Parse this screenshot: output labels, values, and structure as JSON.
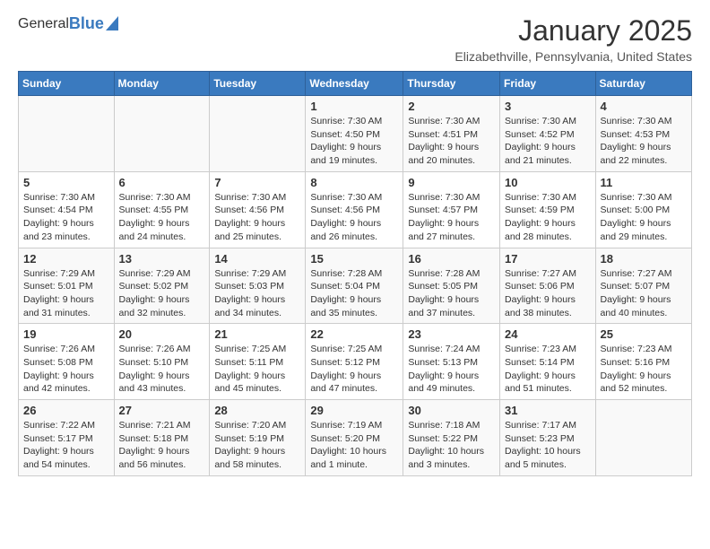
{
  "header": {
    "logo_general": "General",
    "logo_blue": "Blue",
    "month_title": "January 2025",
    "location": "Elizabethville, Pennsylvania, United States"
  },
  "weekdays": [
    "Sunday",
    "Monday",
    "Tuesday",
    "Wednesday",
    "Thursday",
    "Friday",
    "Saturday"
  ],
  "weeks": [
    [
      {
        "day": "",
        "info": ""
      },
      {
        "day": "",
        "info": ""
      },
      {
        "day": "",
        "info": ""
      },
      {
        "day": "1",
        "info": "Sunrise: 7:30 AM\nSunset: 4:50 PM\nDaylight: 9 hours\nand 19 minutes."
      },
      {
        "day": "2",
        "info": "Sunrise: 7:30 AM\nSunset: 4:51 PM\nDaylight: 9 hours\nand 20 minutes."
      },
      {
        "day": "3",
        "info": "Sunrise: 7:30 AM\nSunset: 4:52 PM\nDaylight: 9 hours\nand 21 minutes."
      },
      {
        "day": "4",
        "info": "Sunrise: 7:30 AM\nSunset: 4:53 PM\nDaylight: 9 hours\nand 22 minutes."
      }
    ],
    [
      {
        "day": "5",
        "info": "Sunrise: 7:30 AM\nSunset: 4:54 PM\nDaylight: 9 hours\nand 23 minutes."
      },
      {
        "day": "6",
        "info": "Sunrise: 7:30 AM\nSunset: 4:55 PM\nDaylight: 9 hours\nand 24 minutes."
      },
      {
        "day": "7",
        "info": "Sunrise: 7:30 AM\nSunset: 4:56 PM\nDaylight: 9 hours\nand 25 minutes."
      },
      {
        "day": "8",
        "info": "Sunrise: 7:30 AM\nSunset: 4:56 PM\nDaylight: 9 hours\nand 26 minutes."
      },
      {
        "day": "9",
        "info": "Sunrise: 7:30 AM\nSunset: 4:57 PM\nDaylight: 9 hours\nand 27 minutes."
      },
      {
        "day": "10",
        "info": "Sunrise: 7:30 AM\nSunset: 4:59 PM\nDaylight: 9 hours\nand 28 minutes."
      },
      {
        "day": "11",
        "info": "Sunrise: 7:30 AM\nSunset: 5:00 PM\nDaylight: 9 hours\nand 29 minutes."
      }
    ],
    [
      {
        "day": "12",
        "info": "Sunrise: 7:29 AM\nSunset: 5:01 PM\nDaylight: 9 hours\nand 31 minutes."
      },
      {
        "day": "13",
        "info": "Sunrise: 7:29 AM\nSunset: 5:02 PM\nDaylight: 9 hours\nand 32 minutes."
      },
      {
        "day": "14",
        "info": "Sunrise: 7:29 AM\nSunset: 5:03 PM\nDaylight: 9 hours\nand 34 minutes."
      },
      {
        "day": "15",
        "info": "Sunrise: 7:28 AM\nSunset: 5:04 PM\nDaylight: 9 hours\nand 35 minutes."
      },
      {
        "day": "16",
        "info": "Sunrise: 7:28 AM\nSunset: 5:05 PM\nDaylight: 9 hours\nand 37 minutes."
      },
      {
        "day": "17",
        "info": "Sunrise: 7:27 AM\nSunset: 5:06 PM\nDaylight: 9 hours\nand 38 minutes."
      },
      {
        "day": "18",
        "info": "Sunrise: 7:27 AM\nSunset: 5:07 PM\nDaylight: 9 hours\nand 40 minutes."
      }
    ],
    [
      {
        "day": "19",
        "info": "Sunrise: 7:26 AM\nSunset: 5:08 PM\nDaylight: 9 hours\nand 42 minutes."
      },
      {
        "day": "20",
        "info": "Sunrise: 7:26 AM\nSunset: 5:10 PM\nDaylight: 9 hours\nand 43 minutes."
      },
      {
        "day": "21",
        "info": "Sunrise: 7:25 AM\nSunset: 5:11 PM\nDaylight: 9 hours\nand 45 minutes."
      },
      {
        "day": "22",
        "info": "Sunrise: 7:25 AM\nSunset: 5:12 PM\nDaylight: 9 hours\nand 47 minutes."
      },
      {
        "day": "23",
        "info": "Sunrise: 7:24 AM\nSunset: 5:13 PM\nDaylight: 9 hours\nand 49 minutes."
      },
      {
        "day": "24",
        "info": "Sunrise: 7:23 AM\nSunset: 5:14 PM\nDaylight: 9 hours\nand 51 minutes."
      },
      {
        "day": "25",
        "info": "Sunrise: 7:23 AM\nSunset: 5:16 PM\nDaylight: 9 hours\nand 52 minutes."
      }
    ],
    [
      {
        "day": "26",
        "info": "Sunrise: 7:22 AM\nSunset: 5:17 PM\nDaylight: 9 hours\nand 54 minutes."
      },
      {
        "day": "27",
        "info": "Sunrise: 7:21 AM\nSunset: 5:18 PM\nDaylight: 9 hours\nand 56 minutes."
      },
      {
        "day": "28",
        "info": "Sunrise: 7:20 AM\nSunset: 5:19 PM\nDaylight: 9 hours\nand 58 minutes."
      },
      {
        "day": "29",
        "info": "Sunrise: 7:19 AM\nSunset: 5:20 PM\nDaylight: 10 hours\nand 1 minute."
      },
      {
        "day": "30",
        "info": "Sunrise: 7:18 AM\nSunset: 5:22 PM\nDaylight: 10 hours\nand 3 minutes."
      },
      {
        "day": "31",
        "info": "Sunrise: 7:17 AM\nSunset: 5:23 PM\nDaylight: 10 hours\nand 5 minutes."
      },
      {
        "day": "",
        "info": ""
      }
    ]
  ]
}
